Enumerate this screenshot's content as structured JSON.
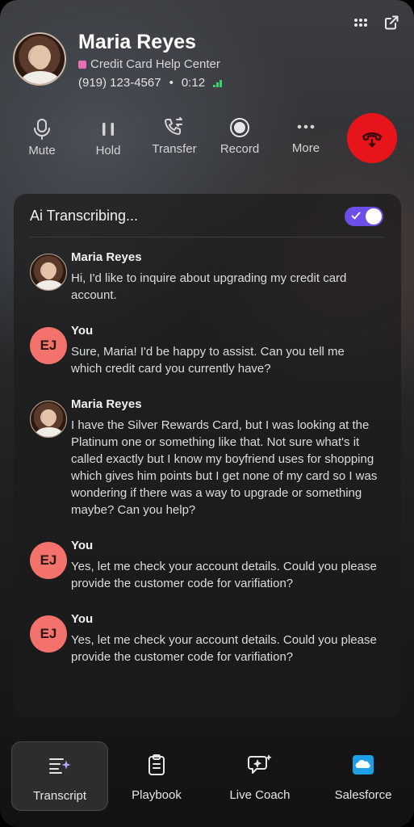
{
  "caller": {
    "name": "Maria Reyes",
    "org": "Credit Card Help Center",
    "phone": "(919) 123-4567",
    "separator": "•",
    "duration": "0:12"
  },
  "controls": [
    {
      "label": "Mute",
      "icon": "microphone-icon"
    },
    {
      "label": "Hold",
      "icon": "pause-icon"
    },
    {
      "label": "Transfer",
      "icon": "phone-transfer-icon"
    },
    {
      "label": "Record",
      "icon": "record-icon"
    },
    {
      "label": "More",
      "icon": "more-dots-icon"
    }
  ],
  "transcript": {
    "title": "Ai Transcribing...",
    "toggle_on": true,
    "messages": [
      {
        "speaker": "Maria Reyes",
        "avatar": "photo",
        "text": "Hi, I'd like to inquire about upgrading my credit card account."
      },
      {
        "speaker": "You",
        "avatar": "EJ",
        "text": "Sure, Maria! I'd be happy to assist. Can you tell me which credit card you currently have?"
      },
      {
        "speaker": "Maria Reyes",
        "avatar": "photo",
        "text": "I have the Silver Rewards Card, but I was looking at the Platinum one or something like that. Not sure what's it called exactly but I know my boyfriend uses for shopping which gives him points but I get none of my card so I was wondering if there was a way to upgrade or something maybe? Can you help?"
      },
      {
        "speaker": "You",
        "avatar": "EJ",
        "text": "Yes, let me check your account details. Could you please provide the customer code for varifiation?"
      },
      {
        "speaker": "You",
        "avatar": "EJ",
        "text": "Yes, let me check your account details. Could you please provide the customer code for varifiation?"
      }
    ]
  },
  "nav": [
    {
      "label": "Transcript",
      "icon": "transcript-icon",
      "active": true
    },
    {
      "label": "Playbook",
      "icon": "clipboard-icon",
      "active": false
    },
    {
      "label": "Live Coach",
      "icon": "sparkle-chat-icon",
      "active": false
    },
    {
      "label": "Salesforce",
      "icon": "salesforce-cloud-icon",
      "active": false
    }
  ],
  "colors": {
    "end_call": "#e8141b",
    "toggle": "#6c4fe8",
    "initials_avatar": "#f3726b",
    "org_badge": "#e96fb5",
    "signal": "#3ed36a"
  }
}
